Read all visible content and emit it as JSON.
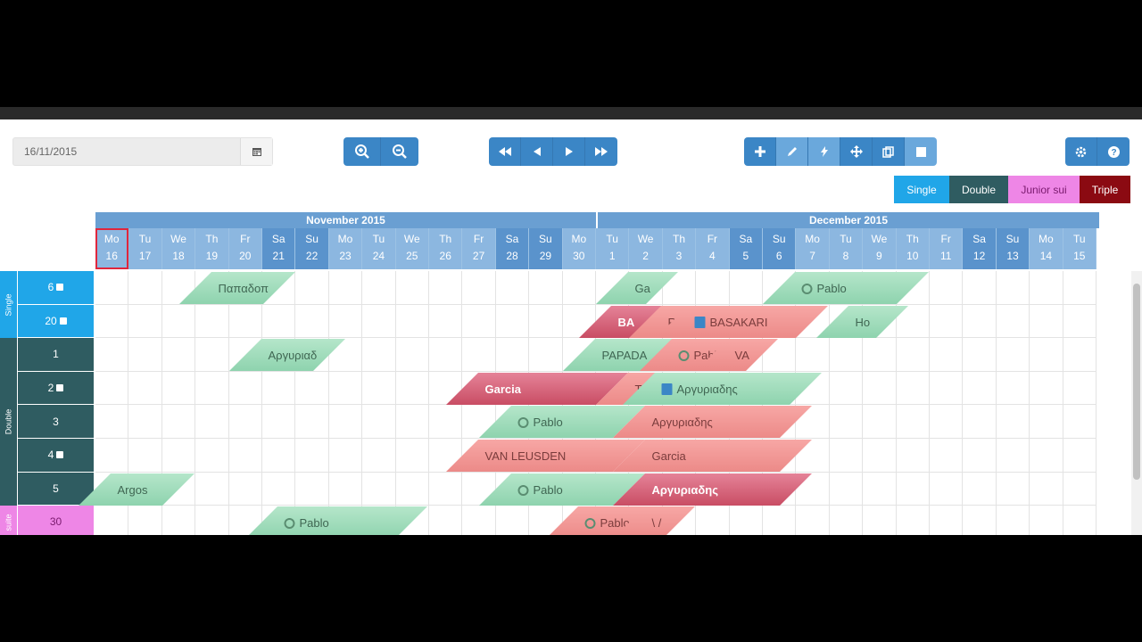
{
  "toolbar": {
    "date_value": "16/11/2015",
    "zoom": [
      "zoom-in-icon",
      "zoom-out-icon"
    ],
    "nav": [
      "fast-backward-icon",
      "backward-icon",
      "forward-icon",
      "fast-forward-icon"
    ],
    "edit": [
      "plus-icon",
      "pencil-icon",
      "bolt-icon",
      "move-icon",
      "copy-icon",
      "square-icon"
    ],
    "settings": [
      "gear-icon",
      "help-icon"
    ]
  },
  "legend": [
    {
      "label": "Single",
      "color": "#20a6e8"
    },
    {
      "label": "Double",
      "color": "#2f5c61"
    },
    {
      "label": "Junior sui",
      "color": "#ee86e6"
    },
    {
      "label": "Triple",
      "color": "#8b0a12"
    }
  ],
  "months": [
    "November 2015",
    "December 2015"
  ],
  "days": [
    {
      "d": "Mo",
      "n": "16",
      "we": false
    },
    {
      "d": "Tu",
      "n": "17",
      "we": false
    },
    {
      "d": "We",
      "n": "18",
      "we": false
    },
    {
      "d": "Th",
      "n": "19",
      "we": false
    },
    {
      "d": "Fr",
      "n": "20",
      "we": false
    },
    {
      "d": "Sa",
      "n": "21",
      "we": true
    },
    {
      "d": "Su",
      "n": "22",
      "we": true
    },
    {
      "d": "Mo",
      "n": "23",
      "we": false
    },
    {
      "d": "Tu",
      "n": "24",
      "we": false
    },
    {
      "d": "We",
      "n": "25",
      "we": false
    },
    {
      "d": "Th",
      "n": "26",
      "we": false
    },
    {
      "d": "Fr",
      "n": "27",
      "we": false
    },
    {
      "d": "Sa",
      "n": "28",
      "we": true
    },
    {
      "d": "Su",
      "n": "29",
      "we": true
    },
    {
      "d": "Mo",
      "n": "30",
      "we": false
    },
    {
      "d": "Tu",
      "n": "1",
      "we": false
    },
    {
      "d": "We",
      "n": "2",
      "we": false
    },
    {
      "d": "Th",
      "n": "3",
      "we": false
    },
    {
      "d": "Fr",
      "n": "4",
      "we": false
    },
    {
      "d": "Sa",
      "n": "5",
      "we": true
    },
    {
      "d": "Su",
      "n": "6",
      "we": true
    },
    {
      "d": "Mo",
      "n": "7",
      "we": false
    },
    {
      "d": "Tu",
      "n": "8",
      "we": false
    },
    {
      "d": "We",
      "n": "9",
      "we": false
    },
    {
      "d": "Th",
      "n": "10",
      "we": false
    },
    {
      "d": "Fr",
      "n": "11",
      "we": false
    },
    {
      "d": "Sa",
      "n": "12",
      "we": true
    },
    {
      "d": "Su",
      "n": "13",
      "we": true
    },
    {
      "d": "Mo",
      "n": "14",
      "we": false
    },
    {
      "d": "Tu",
      "n": "15",
      "we": false
    }
  ],
  "categories": [
    {
      "label": "Single",
      "rows": 2,
      "type": "single"
    },
    {
      "label": "Double",
      "rows": 5,
      "type": "double"
    },
    {
      "label": "suite",
      "rows": 1,
      "type": "junior"
    }
  ],
  "rooms": [
    {
      "label": "6",
      "type": "single",
      "bed": true
    },
    {
      "label": "20",
      "type": "single",
      "bed": true
    },
    {
      "label": "1",
      "type": "double",
      "bed": false
    },
    {
      "label": "2",
      "type": "double",
      "bed": true
    },
    {
      "label": "3",
      "type": "double",
      "bed": false
    },
    {
      "label": "4",
      "type": "double",
      "bed": true
    },
    {
      "label": "5",
      "type": "double",
      "bed": false
    },
    {
      "label": "30",
      "type": "junior",
      "bed": false
    }
  ],
  "bookings": [
    {
      "row": 0,
      "start": 2.5,
      "len": 2.5,
      "color": "green",
      "label": "Παπαδοπ",
      "icon": ""
    },
    {
      "row": 0,
      "start": 15,
      "len": 1.5,
      "color": "green",
      "label": "Ga",
      "icon": ""
    },
    {
      "row": 0,
      "start": 20,
      "len": 4,
      "color": "green",
      "label": "Pablo",
      "icon": "circle"
    },
    {
      "row": 1,
      "start": 14.5,
      "len": 1.7,
      "color": "dred",
      "label": "BA",
      "icon": ""
    },
    {
      "row": 1,
      "start": 16,
      "len": 1.5,
      "color": "red",
      "label": "RO",
      "icon": ""
    },
    {
      "row": 1,
      "start": 16.8,
      "len": 4.2,
      "color": "red",
      "label": "BASAKARI",
      "icon": "doc"
    },
    {
      "row": 1,
      "start": 21.6,
      "len": 1.8,
      "color": "green",
      "label": "Ho",
      "icon": ""
    },
    {
      "row": 2,
      "start": 4,
      "len": 2.5,
      "color": "green",
      "label": "Αργυριαδ",
      "icon": ""
    },
    {
      "row": 2,
      "start": 14,
      "len": 3,
      "color": "green",
      "label": "PAPADA",
      "icon": ""
    },
    {
      "row": 2,
      "start": 16.3,
      "len": 2.3,
      "color": "red",
      "label": "Pablo",
      "icon": "circle"
    },
    {
      "row": 2,
      "start": 18,
      "len": 1.5,
      "color": "red",
      "label": "VA",
      "icon": ""
    },
    {
      "row": 3,
      "start": 10.5,
      "len": 4.5,
      "color": "dred",
      "label": "Garcia",
      "icon": ""
    },
    {
      "row": 3,
      "start": 15,
      "len": 1.5,
      "color": "red",
      "label": "TA",
      "icon": ""
    },
    {
      "row": 3,
      "start": 15.8,
      "len": 5,
      "color": "green",
      "label": "Αργυριαδης",
      "icon": "doc"
    },
    {
      "row": 4,
      "start": 11.5,
      "len": 4,
      "color": "green",
      "label": "Pablo",
      "icon": "circle"
    },
    {
      "row": 4,
      "start": 15.5,
      "len": 5,
      "color": "red",
      "label": "Αργυριαδης",
      "icon": ""
    },
    {
      "row": 5,
      "start": 10.5,
      "len": 5,
      "color": "red",
      "label": "VAN LEUSDEN",
      "icon": ""
    },
    {
      "row": 5,
      "start": 15.5,
      "len": 5,
      "color": "red",
      "label": "Garcia",
      "icon": ""
    },
    {
      "row": 6,
      "start": -0.5,
      "len": 2.5,
      "color": "green",
      "label": "Argos",
      "icon": ""
    },
    {
      "row": 6,
      "start": 11.5,
      "len": 4,
      "color": "green",
      "label": "Pablo",
      "icon": "circle"
    },
    {
      "row": 6,
      "start": 15.5,
      "len": 5,
      "color": "dred",
      "label": "Αργυριαδης",
      "icon": ""
    },
    {
      "row": 7,
      "start": 4.5,
      "len": 4.5,
      "color": "green",
      "label": "Pablo",
      "icon": "circle"
    },
    {
      "row": 7,
      "start": 13.5,
      "len": 2.5,
      "color": "red",
      "label": "Pablo",
      "icon": "circle"
    },
    {
      "row": 7,
      "start": 15.5,
      "len": 1.5,
      "color": "red",
      "label": "\\ /",
      "icon": ""
    }
  ]
}
